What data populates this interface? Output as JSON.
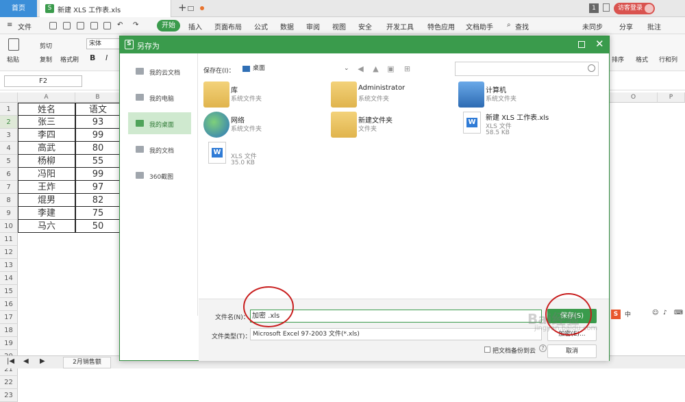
{
  "titlebar": {
    "home_tab": "首页",
    "doc_tab": "新建 XLS 工作表.xls",
    "doc_tab_icon": "S",
    "new_tab": "+",
    "badge": "1",
    "visitor": "访客登录"
  },
  "menu": {
    "file": "文件",
    "start": "开始",
    "insert": "插入",
    "layout": "页面布局",
    "formula": "公式",
    "data": "数据",
    "review": "审阅",
    "view": "视图",
    "security": "安全",
    "devtools": "开发工具",
    "special": "特色应用",
    "doc_helper": "文档助手",
    "find": "查找",
    "unsync": "未同步",
    "share": "分享",
    "annotate": "批注"
  },
  "ribbon": {
    "cut": "剪切",
    "copy": "复制",
    "paste": "粘贴",
    "format_painter": "格式刷",
    "font": "宋体",
    "bold": "B",
    "italic": "I",
    "sort": "排序",
    "format": "格式",
    "rowcol": "行和列"
  },
  "formula_bar": {
    "name_box": "F2"
  },
  "sheet": {
    "columns": [
      "A",
      "B"
    ],
    "right_columns": [
      "O",
      "P"
    ],
    "row_numbers": [
      "1",
      "2",
      "3",
      "4",
      "5",
      "6",
      "7",
      "8",
      "9",
      "10",
      "11",
      "12",
      "13",
      "14",
      "15",
      "16",
      "17",
      "18",
      "19",
      "20",
      "21",
      "22",
      "23"
    ],
    "header": [
      "姓名",
      "语文"
    ],
    "rows": [
      [
        "张三",
        "93"
      ],
      [
        "李四",
        "99"
      ],
      [
        "高武",
        "80"
      ],
      [
        "杨柳",
        "55"
      ],
      [
        "冯阳",
        "99"
      ],
      [
        "王炸",
        "97"
      ],
      [
        "焜男",
        "82"
      ],
      [
        "李建",
        "75"
      ],
      [
        "马六",
        "50"
      ]
    ],
    "sheet_tab": "2月销售额"
  },
  "dialog": {
    "title": "另存为",
    "logo": "S",
    "sidebar": [
      {
        "label": "我的云文档"
      },
      {
        "label": "我的电脑"
      },
      {
        "label": "我的桌面"
      },
      {
        "label": "我的文档"
      },
      {
        "label": "360截图"
      }
    ],
    "save_in_label": "保存在(I)：",
    "save_in_value": "桌面",
    "files": [
      {
        "name": "库",
        "sub": "系统文件夹",
        "size": ""
      },
      {
        "name": "Administrator",
        "sub": "系统文件夹",
        "size": ""
      },
      {
        "name": "计算机",
        "sub": "系统文件夹",
        "size": ""
      },
      {
        "name": "网络",
        "sub": "系统文件夹",
        "size": ""
      },
      {
        "name": "新建文件夹",
        "sub": "文件夹",
        "size": ""
      },
      {
        "name": "新建 XLS 工作表.xls",
        "sub": "XLS 文件",
        "size": "58.5 KB"
      },
      {
        "name": "",
        "sub": "XLS 文件",
        "size": "35.0 KB"
      }
    ],
    "filename_label": "文件名(N)：",
    "filename_value": "加密 .xls",
    "filetype_label": "文件类型(T)：",
    "filetype_value": "Microsoft Excel 97-2003 文件(*.xls)",
    "save_button": "保存(S)",
    "encrypt_button": "加密(E)...",
    "cancel_button": "取消",
    "backup_label": "把文档备份到云",
    "help": "?"
  },
  "watermark": {
    "main": "Bai经验",
    "sub": "jingyan.baidu.com"
  },
  "ime": {
    "logo": "S"
  }
}
